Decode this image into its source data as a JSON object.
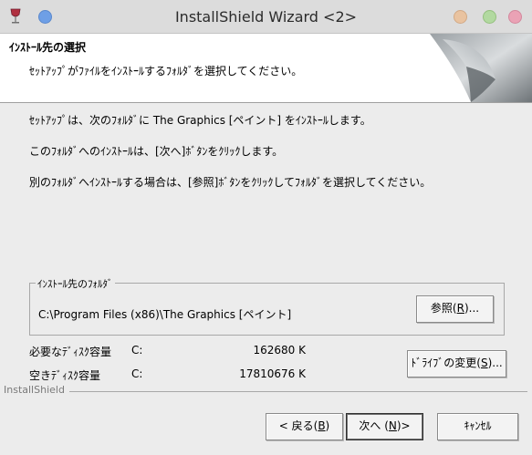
{
  "window": {
    "title": "InstallShield Wizard <2>"
  },
  "header": {
    "title": "ｲﾝｽﾄｰﾙ先の選択",
    "subtitle": "ｾｯﾄｱｯﾌﾟがﾌｧｲﾙをｲﾝｽﾄｰﾙするﾌｫﾙﾀﾞを選択してください。"
  },
  "body": {
    "line1": "ｾｯﾄｱｯﾌﾟは、次のﾌｫﾙﾀﾞに The Graphics [ペイント] をｲﾝｽﾄｰﾙします。",
    "line2": "このﾌｫﾙﾀﾞへのｲﾝｽﾄｰﾙは、[次へ]ﾎﾞﾀﾝをｸﾘｯｸします。",
    "line3": "別のﾌｫﾙﾀﾞへｲﾝｽﾄｰﾙする場合は、[参照]ﾎﾞﾀﾝをｸﾘｯｸしてﾌｫﾙﾀﾞを選択してください。"
  },
  "destination": {
    "group_label": "ｲﾝｽﾄｰﾙ先のﾌｫﾙﾀﾞ",
    "path": "C:\\Program Files (x86)\\The Graphics [ペイント]",
    "browse_pre": "参照(",
    "browse_key": "R",
    "browse_post": ")..."
  },
  "disk_space": {
    "required_label": "必要なﾃﾞｨｽｸ容量",
    "required_drive": "C:",
    "required_value": "162680 K",
    "free_label": "空きﾃﾞｨｽｸ容量",
    "free_drive": "C:",
    "free_value": "17810676 K",
    "change_pre": "ﾄﾞﾗｲﾌﾞの変更(",
    "change_key": "S",
    "change_post": ")..."
  },
  "footer": {
    "brand": "InstallShield",
    "back_pre": "< 戻る(",
    "back_key": "B",
    "back_post": ")",
    "next_pre": "次へ (",
    "next_key": "N",
    "next_post": ")>",
    "cancel_label": "ｷｬﾝｾﾙ"
  },
  "colors": {
    "title_bar": "#dcdcdc",
    "dialog_bg": "#ececec",
    "header_bg": "#ffffff"
  },
  "icons": [
    "wine-glass-icon",
    "window-menu-icon",
    "minimize-icon",
    "maximize-icon",
    "close-icon",
    "page-curl-graphic"
  ]
}
